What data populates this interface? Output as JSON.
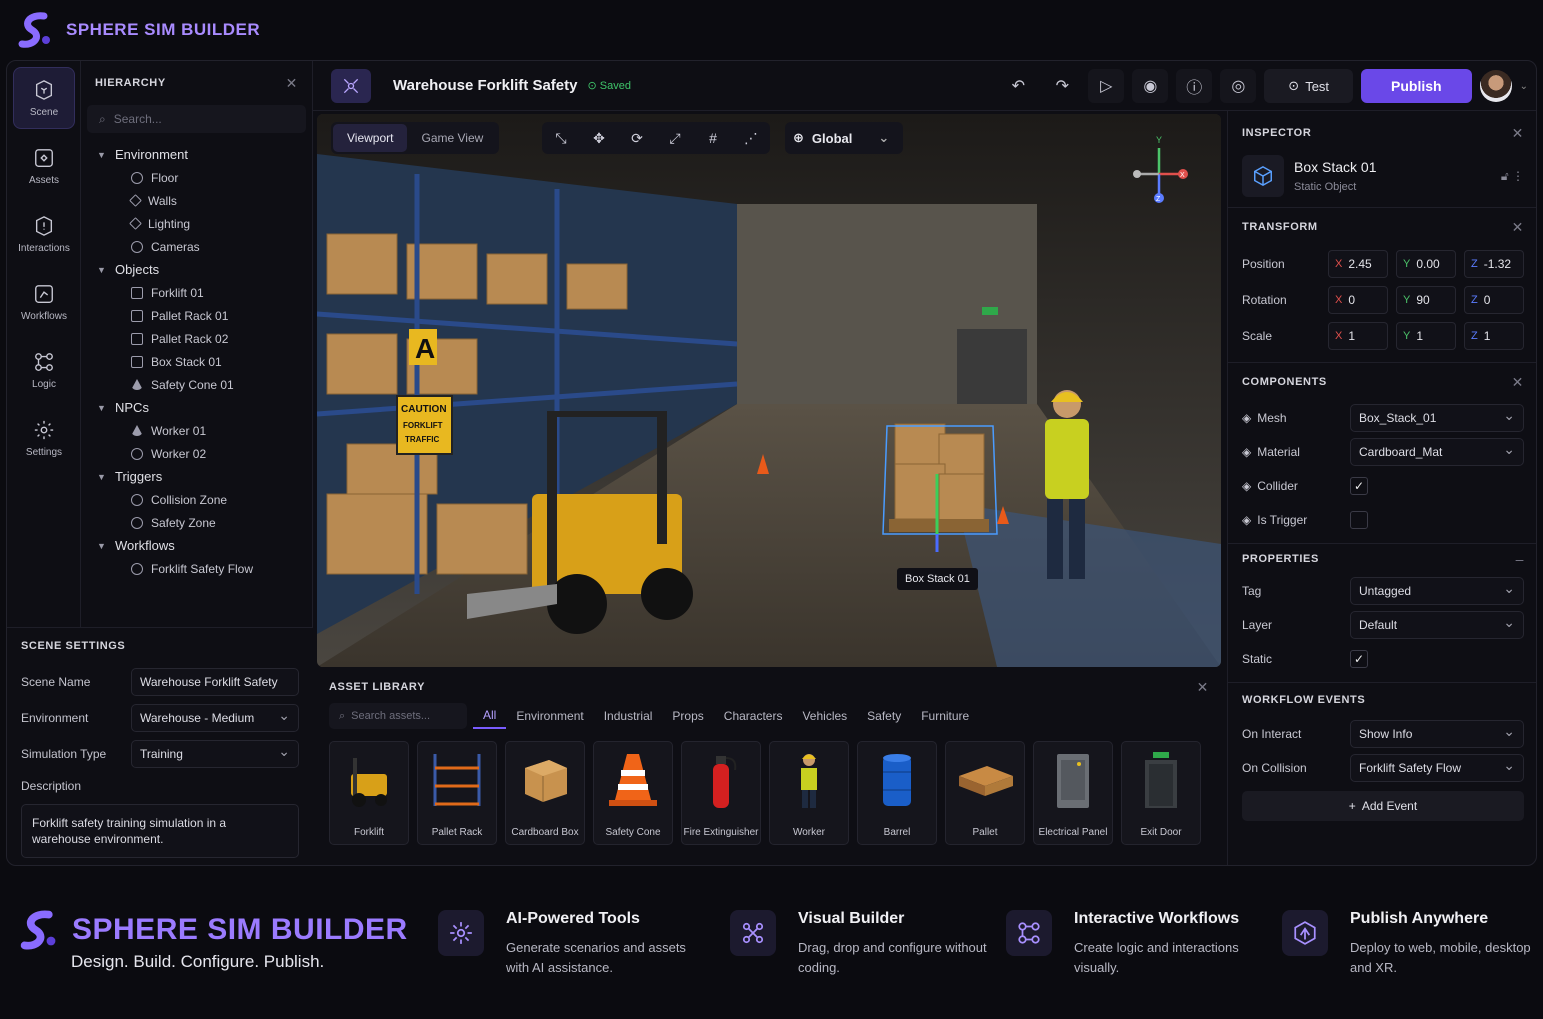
{
  "brand": {
    "name": "SPHERE SIM BUILDER"
  },
  "rail": [
    {
      "label": "Scene",
      "icon": "scene-icon"
    },
    {
      "label": "Assets",
      "icon": "assets-icon"
    },
    {
      "label": "Interactions",
      "icon": "interactions-icon"
    },
    {
      "label": "Workflows",
      "icon": "workflows-icon"
    },
    {
      "label": "Logic",
      "icon": "logic-icon"
    },
    {
      "label": "Settings",
      "icon": "gear-icon"
    }
  ],
  "hierarchy": {
    "title": "HIERARCHY",
    "search_placeholder": "Search...",
    "groups": [
      {
        "name": "Environment",
        "items": [
          "Floor",
          "Walls",
          "Lighting",
          "Cameras"
        ]
      },
      {
        "name": "Objects",
        "items": [
          "Forklift 01",
          "Pallet Rack 01",
          "Pallet Rack 02",
          "Box Stack 01",
          "Safety Cone 01"
        ]
      },
      {
        "name": "NPCs",
        "items": [
          "Worker 01",
          "Worker 02"
        ]
      },
      {
        "name": "Triggers",
        "items": [
          "Collision Zone",
          "Safety Zone"
        ]
      },
      {
        "name": "Workflows",
        "items": [
          "Forklift Safety Flow"
        ]
      }
    ]
  },
  "scene_settings": {
    "title": "SCENE SETTINGS",
    "scene_name_label": "Scene Name",
    "scene_name": "Warehouse Forklift Safety",
    "environment_label": "Environment",
    "environment": "Warehouse - Medium",
    "sim_type_label": "Simulation Type",
    "sim_type": "Training",
    "description_label": "Description",
    "description": "Forklift safety training simulation in a warehouse environment."
  },
  "topbar": {
    "title": "Warehouse Forklift Safety",
    "status": "Saved",
    "test_label": "Test",
    "publish_label": "Publish"
  },
  "viewport": {
    "tabs": [
      "Viewport",
      "Game View"
    ],
    "space": "Global",
    "selection_label": "Box Stack 01",
    "sign_letter": "A",
    "caution_text": [
      "CAUTION",
      "FORKLIFT",
      "TRAFFIC"
    ],
    "gizmo_axes": [
      "Y",
      "X",
      "Z"
    ]
  },
  "asset_library": {
    "title": "ASSET LIBRARY",
    "search_placeholder": "Search assets...",
    "tabs": [
      "All",
      "Environment",
      "Industrial",
      "Props",
      "Characters",
      "Vehicles",
      "Safety",
      "Furniture"
    ],
    "items": [
      "Forklift",
      "Pallet Rack",
      "Cardboard Box",
      "Safety Cone",
      "Fire Extinguisher",
      "Worker",
      "Barrel",
      "Pallet",
      "Electrical Panel",
      "Exit Door"
    ]
  },
  "inspector": {
    "title": "INSPECTOR",
    "object_name": "Box Stack 01",
    "object_type": "Static Object",
    "transform": {
      "title": "TRANSFORM",
      "position_label": "Position",
      "position": [
        "2.45",
        "0.00",
        "-1.32"
      ],
      "rotation_label": "Rotation",
      "rotation": [
        "0",
        "90",
        "0"
      ],
      "scale_label": "Scale",
      "scale": [
        "1",
        "1",
        "1"
      ],
      "axes": [
        "X",
        "Y",
        "Z"
      ]
    },
    "components": {
      "title": "COMPONENTS",
      "mesh_label": "Mesh",
      "mesh": "Box_Stack_01",
      "material_label": "Material",
      "material": "Cardboard_Mat",
      "collider_label": "Collider",
      "collider": true,
      "trigger_label": "Is Trigger",
      "trigger": false
    },
    "properties": {
      "title": "PROPERTIES",
      "tag_label": "Tag",
      "tag": "Untagged",
      "layer_label": "Layer",
      "layer": "Default",
      "static_label": "Static",
      "static": true
    },
    "workflow_events": {
      "title": "WORKFLOW EVENTS",
      "interact_label": "On Interact",
      "interact": "Show Info",
      "collision_label": "On Collision",
      "collision": "Forklift Safety Flow",
      "add_label": "Add Event"
    }
  },
  "footer": {
    "brand": "SPHERE SIM BUILDER",
    "tagline": "Design. Build. Configure. Publish.",
    "features": [
      {
        "title": "AI-Powered Tools",
        "desc": "Generate scenarios and assets with AI assistance."
      },
      {
        "title": "Visual Builder",
        "desc": "Drag, drop and configure without coding."
      },
      {
        "title": "Interactive Workflows",
        "desc": "Create logic and interactions visually."
      },
      {
        "title": "Publish Anywhere",
        "desc": "Deploy to web, mobile, desktop and XR."
      }
    ]
  },
  "colors": {
    "accent": "#6a48e8",
    "saved": "#3fc46a",
    "x_axis": "#e0504c",
    "y_axis": "#4cc46a",
    "z_axis": "#5b7cff"
  }
}
